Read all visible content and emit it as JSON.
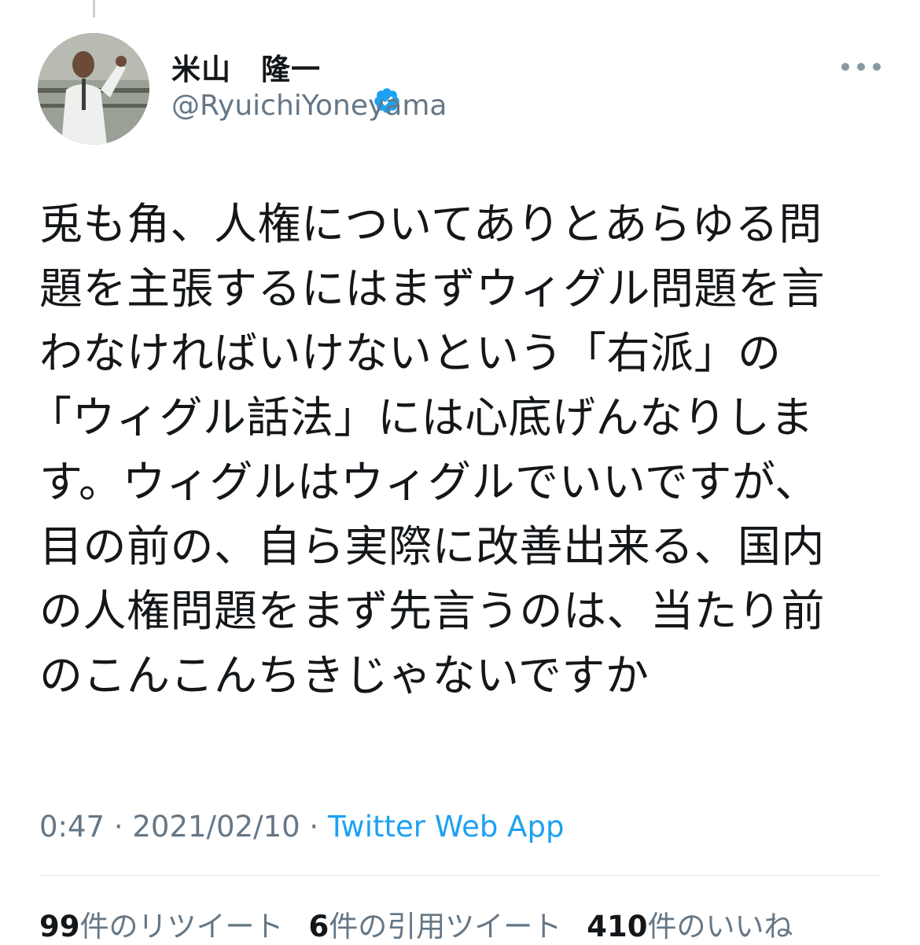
{
  "tweet": {
    "author_name": "米山　隆一",
    "handle": "@RyuichiYoneyama",
    "lines": [
      "兎も角、人権についてありとあらゆる問",
      "題を主張するにはまずウィグル問題を言",
      "わなければいけないという「右派」の",
      "「ウィグル話法」には心底げんなりしま",
      "す。ウィグルはウィグルでいいですが、",
      "目の前の、自ら実際に改善出来る、国内",
      "の人権問題をまず先言うのは、当たり前",
      "のこんこんちきじゃないですか"
    ],
    "time": "0:47",
    "date": "2021/02/10",
    "separator": " · ",
    "source": "Twitter Web App"
  },
  "stats": {
    "retweets_count": "99",
    "retweets_label": "件のリツイート",
    "quotes_count": "6",
    "quotes_label": "件の引用ツイート",
    "likes_count": "410",
    "likes_label": "件のいいね"
  },
  "icons": {
    "verified": "verified-badge-icon",
    "more": "more-options-icon"
  },
  "colors": {
    "text": "#14171a",
    "secondary": "#657786",
    "link": "#1da1f2",
    "verified": "#1da1f2"
  }
}
